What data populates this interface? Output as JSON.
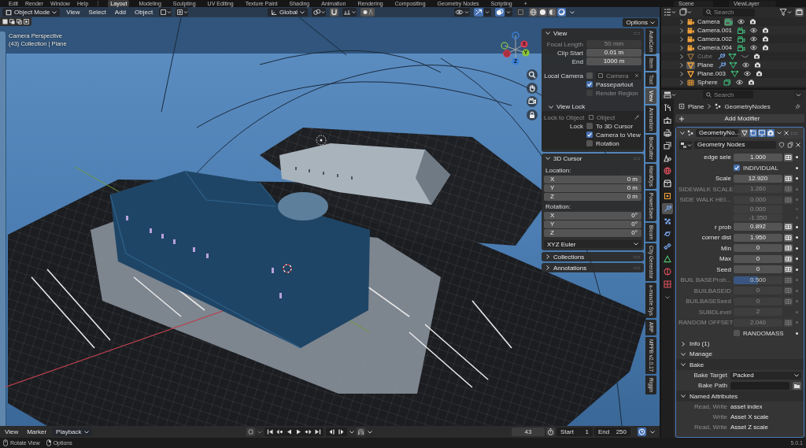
{
  "topbar": {
    "menus": [
      "Edit",
      "Render",
      "Window",
      "Help"
    ],
    "workspaces": [
      {
        "label": "Layout",
        "selected": true
      },
      {
        "label": "Modeling",
        "selected": false
      },
      {
        "label": "Sculpting",
        "selected": false
      },
      {
        "label": "UV Editing",
        "selected": false
      },
      {
        "label": "Texture Paint",
        "selected": false
      },
      {
        "label": "Shading",
        "selected": false
      },
      {
        "label": "Animation",
        "selected": false
      },
      {
        "label": "Rendering",
        "selected": false
      },
      {
        "label": "Compositing",
        "selected": false
      },
      {
        "label": "Geometry Nodes",
        "selected": false
      },
      {
        "label": "Scripting",
        "selected": false
      }
    ],
    "add_workspace": "+",
    "scene": "Scene",
    "view_layer": "ViewLayer"
  },
  "viewport": {
    "mode": "Object Mode",
    "menus": [
      "View",
      "Select",
      "Add",
      "Object"
    ],
    "orientation": "Global",
    "show_gizmos": true,
    "show_overlays": true,
    "xray": false,
    "shading": [
      {
        "kind": "wireframe",
        "selected": false
      },
      {
        "kind": "solid",
        "selected": false
      },
      {
        "kind": "material",
        "selected": false
      },
      {
        "kind": "rendered",
        "selected": true
      }
    ],
    "options": "Options",
    "view_name": "Camera Perspective",
    "view_info": "(43) Collection | Plane",
    "gizmo_labels": [
      "X",
      "Y",
      "Z"
    ]
  },
  "sidebar": {
    "tabs": [
      {
        "label": "AutoCam",
        "selected": false
      },
      {
        "label": "Item",
        "selected": false
      },
      {
        "label": "Tool",
        "selected": false
      },
      {
        "label": "View",
        "selected": true
      },
      {
        "label": "Animation",
        "selected": false
      },
      {
        "label": "BoxCutter",
        "selected": false
      },
      {
        "label": "HardOps",
        "selected": false
      },
      {
        "label": "PowerSave",
        "selected": false
      },
      {
        "label": "Bloom",
        "selected": false
      },
      {
        "label": "City Generator",
        "selected": false
      },
      {
        "label": "x-muscle Sys",
        "selected": false
      },
      {
        "label": "ARP",
        "selected": false
      },
      {
        "label": "MPFB v2.0.17",
        "selected": false
      },
      {
        "label": "Riggin",
        "selected": false
      }
    ],
    "panels": [
      {
        "title": "View",
        "expanded": true,
        "rows": [
          {
            "kind": "field",
            "label": "Focal Length",
            "value": "50 mm",
            "enabled": false
          },
          {
            "kind": "field",
            "label": "Clip Start",
            "value": "0.01 m",
            "enabled": true
          },
          {
            "kind": "field",
            "label": "End",
            "value": "1000 m",
            "enabled": true
          },
          {
            "kind": "object",
            "label": "Local Camera",
            "checked": false,
            "value": "Camera",
            "enabled": false
          },
          {
            "kind": "checkbox",
            "text": "Passepartout",
            "checked": true,
            "enabled": true
          },
          {
            "kind": "checkbox",
            "text": "Render Region",
            "checked": false,
            "enabled": false
          },
          {
            "kind": "subpanel",
            "title": "View Lock",
            "expanded": true,
            "rows": [
              {
                "kind": "picker",
                "label": "Lock to Object",
                "placeholder": "Object",
                "enabled": false
              },
              {
                "kind": "checkbox",
                "label": "Lock",
                "text": "To 3D Cursor",
                "checked": false,
                "enabled": true
              },
              {
                "kind": "checkbox",
                "text": "Camera to View",
                "checked": true,
                "enabled": true
              },
              {
                "kind": "checkbox",
                "text": "Rotation",
                "checked": false,
                "enabled": true
              }
            ]
          }
        ]
      },
      {
        "title": "3D Cursor",
        "expanded": true,
        "rows": [
          {
            "kind": "heading",
            "text": "Location:"
          },
          {
            "kind": "vector",
            "fields": [
              {
                "axis": "X",
                "value": "0 m"
              },
              {
                "axis": "Y",
                "value": "0 m"
              },
              {
                "axis": "Z",
                "value": "0 m"
              }
            ]
          },
          {
            "kind": "heading",
            "text": "Rotation:"
          },
          {
            "kind": "vector",
            "fields": [
              {
                "axis": "X",
                "value": "0°"
              },
              {
                "axis": "Y",
                "value": "0°"
              },
              {
                "axis": "Z",
                "value": "0°"
              }
            ]
          },
          {
            "kind": "dropdown",
            "value": "XYZ Euler"
          }
        ]
      },
      {
        "title": "Collections",
        "expanded": false
      },
      {
        "title": "Annotations",
        "expanded": false
      }
    ]
  },
  "outliner": {
    "search_placeholder": "Search",
    "rows": [
      {
        "name": "Camera",
        "kind": "camera",
        "expanded": false,
        "visible": true,
        "active": false,
        "modifiers": false,
        "data_active": true
      },
      {
        "name": "Camera.001",
        "kind": "camera",
        "expanded": false,
        "visible": true,
        "active": false,
        "modifiers": false,
        "data_active": false
      },
      {
        "name": "Camera.002",
        "kind": "camera",
        "expanded": false,
        "visible": true,
        "active": false,
        "modifiers": false,
        "data_active": false
      },
      {
        "name": "Camera.004",
        "kind": "camera",
        "expanded": false,
        "visible": true,
        "active": false,
        "modifiers": false,
        "data_active": false
      },
      {
        "name": "Cube",
        "kind": "mesh",
        "expanded": false,
        "visible": false,
        "active": false,
        "modifiers": true,
        "data_active": false
      },
      {
        "name": "Plane",
        "kind": "mesh",
        "expanded": false,
        "visible": true,
        "active": true,
        "modifiers": true,
        "data_active": false
      },
      {
        "name": "Plane.003",
        "kind": "mesh",
        "expanded": false,
        "visible": true,
        "active": false,
        "modifiers": false,
        "data_active": false
      },
      {
        "name": "Sphere",
        "kind": "lattice",
        "expanded": false,
        "visible": true,
        "active": false,
        "modifiers": false,
        "data_active": false
      }
    ]
  },
  "properties": {
    "search_placeholder": "Search",
    "tabs": [
      {
        "kind": "tool",
        "selected": false
      },
      {
        "kind": "render",
        "selected": false
      },
      {
        "kind": "output",
        "selected": false
      },
      {
        "kind": "view_layer",
        "selected": false
      },
      {
        "kind": "scene",
        "selected": false
      },
      {
        "kind": "world",
        "selected": false
      },
      {
        "kind": "collection",
        "selected": false
      },
      {
        "kind": "object",
        "selected": false
      },
      {
        "kind": "modifier",
        "selected": true
      },
      {
        "kind": "particles",
        "selected": false
      },
      {
        "kind": "physics",
        "selected": false
      },
      {
        "kind": "constraints",
        "selected": false
      },
      {
        "kind": "data",
        "selected": false
      },
      {
        "kind": "material",
        "selected": false
      },
      {
        "kind": "texture",
        "selected": false
      }
    ],
    "breadcrumb": [
      "Plane",
      "GeometryNodes"
    ],
    "add_modifier": "Add Modifier",
    "modifier": {
      "name": "GeometryNo...",
      "expanded": true,
      "active": true,
      "toggles": [
        {
          "kind": "cage",
          "on": false
        },
        {
          "kind": "editmode",
          "on": true
        },
        {
          "kind": "viewport",
          "on": true
        },
        {
          "kind": "render",
          "on": true
        }
      ],
      "node_group": "Geometry Nodes",
      "inputs": [
        {
          "kind": "number",
          "label": "edge sele",
          "value": "1.000",
          "enabled": true
        },
        {
          "kind": "checkbox",
          "label": "INDIVIDUAL",
          "checked": true,
          "enabled": true
        },
        {
          "kind": "number",
          "label": "Scale",
          "value": "12.920",
          "enabled": true
        },
        {
          "kind": "number",
          "label": "SIDEWALK SCALE",
          "value": "1.260",
          "enabled": false
        },
        {
          "kind": "vector",
          "label": "SIDE WALK HEI...",
          "values": [
            "0.000",
            "0.000",
            "-1.350"
          ],
          "enabled": false
        },
        {
          "kind": "number",
          "label": "r prob",
          "value": "0.892",
          "enabled": true
        },
        {
          "kind": "number",
          "label": "corner dist",
          "value": "1.950",
          "enabled": true
        },
        {
          "kind": "number",
          "label": "Min",
          "value": "0",
          "enabled": true
        },
        {
          "kind": "number",
          "label": "Max",
          "value": "0",
          "enabled": true
        },
        {
          "kind": "number",
          "label": "Seed",
          "value": "0",
          "enabled": true
        },
        {
          "kind": "slider",
          "label": "BUIL BASEProb...",
          "value": "0.500",
          "level": 0.5,
          "enabled": false
        },
        {
          "kind": "number",
          "label": "BUILBASEID",
          "value": "0",
          "enabled": false
        },
        {
          "kind": "number",
          "label": "BUILBASESeed",
          "value": "0",
          "enabled": false
        },
        {
          "kind": "integer",
          "label": "SUBDLevel",
          "value": "2",
          "enabled": false
        },
        {
          "kind": "number",
          "label": "RANDOM OFFSET",
          "value": "2.040",
          "enabled": false
        },
        {
          "kind": "checkbox",
          "label": "RANDOMASS",
          "checked": false,
          "enabled": true
        }
      ],
      "panels": [
        {
          "title": "Info (1)",
          "expanded": false
        },
        {
          "title": "Manage",
          "expanded": true,
          "children": [
            {
              "title": "Bake",
              "expanded": true,
              "target_label": "Bake Target",
              "target": "Packed",
              "path_label": "Bake Path"
            },
            {
              "title": "Named Attributes",
              "expanded": true,
              "attributes": [
                {
                  "usage": "Read, Write",
                  "name": "asset index"
                },
                {
                  "usage": "Write",
                  "name": "Asset X scale"
                },
                {
                  "usage": "Read, Write",
                  "name": "Asset Z scale"
                }
              ]
            }
          ]
        }
      ]
    }
  },
  "timeline": {
    "menus": [
      "View",
      "Marker"
    ],
    "playback": "Playback",
    "frame": "43",
    "start_label": "Start",
    "start": "1",
    "end_label": "End",
    "end": "250"
  },
  "status_bar": {
    "hints": [
      {
        "kind": "rotate",
        "text": "Rotate View"
      },
      {
        "kind": "options",
        "text": "Options"
      }
    ],
    "version": "5.0.1"
  }
}
